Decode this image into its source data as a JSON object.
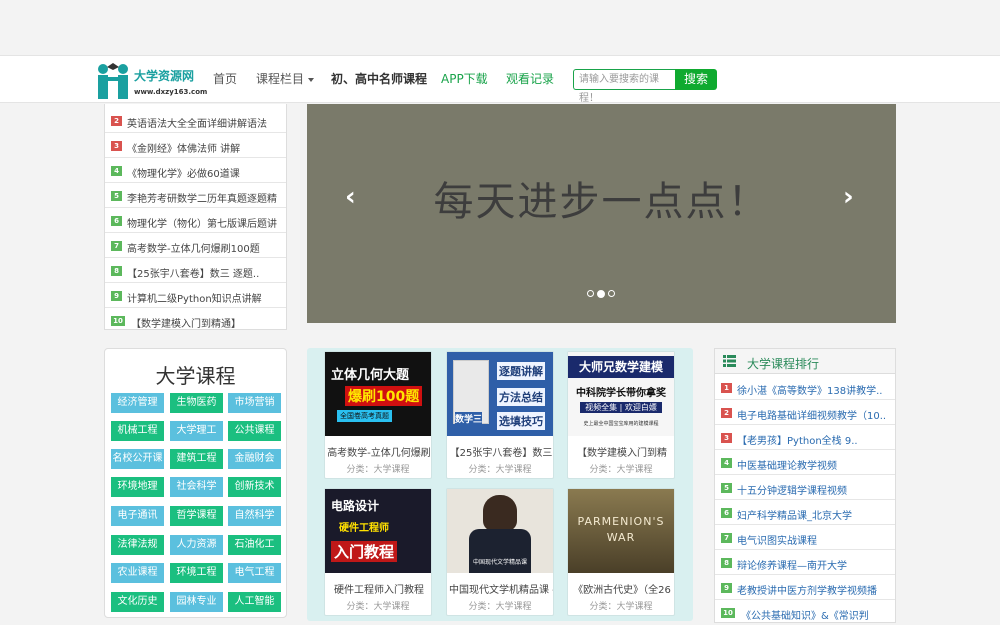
{
  "site": {
    "name": "大学资源网",
    "url": "www.dxzy163.com"
  },
  "nav": {
    "home": "首页",
    "courses": "课程栏目",
    "teachers": "初、高中名师课程",
    "app": "APP下载",
    "history": "观看记录",
    "search_placeholder": "请输入要搜索的课程！",
    "search_button": "搜索"
  },
  "left_list": [
    {
      "num": "2",
      "text": "英语语法大全全面详细讲解语法",
      "color": "#d9534f"
    },
    {
      "num": "3",
      "text": "《金刚经》体佛法师 讲解",
      "color": "#d9534f"
    },
    {
      "num": "4",
      "text": "《物理化学》必做60道课",
      "color": "#5cb85c"
    },
    {
      "num": "5",
      "text": "李艳芳考研数学二历年真题逐题精",
      "color": "#5cb85c"
    },
    {
      "num": "6",
      "text": "物理化学（物化）第七版课后题讲",
      "color": "#5cb85c"
    },
    {
      "num": "7",
      "text": "高考数学-立体几何爆刷100题",
      "color": "#5cb85c"
    },
    {
      "num": "8",
      "text": "【25张宇八套卷】数三 逐题..",
      "color": "#5cb85c"
    },
    {
      "num": "9",
      "text": "计算机二级Python知识点讲解",
      "color": "#5cb85c"
    },
    {
      "num": "10",
      "text": "【数学建模入门到精通】",
      "color": "#5cb85c"
    }
  ],
  "banner": {
    "text": "每天进步一点点！",
    "prev": "‹",
    "next": "›"
  },
  "categories": {
    "title": "大学课程",
    "tags": [
      {
        "label": "经济管理",
        "style": "blue"
      },
      {
        "label": "生物医药",
        "style": "green"
      },
      {
        "label": "市场营销",
        "style": "blue"
      },
      {
        "label": "机械工程",
        "style": "green"
      },
      {
        "label": "大学理工",
        "style": "blue"
      },
      {
        "label": "公共课程",
        "style": "green"
      },
      {
        "label": "名校公开课",
        "style": "blue"
      },
      {
        "label": "建筑工程",
        "style": "green"
      },
      {
        "label": "金融财会",
        "style": "blue"
      },
      {
        "label": "环境地理",
        "style": "green"
      },
      {
        "label": "社会科学",
        "style": "blue"
      },
      {
        "label": "创新技术",
        "style": "green"
      },
      {
        "label": "电子通讯",
        "style": "blue"
      },
      {
        "label": "哲学课程",
        "style": "green"
      },
      {
        "label": "自然科学",
        "style": "blue"
      },
      {
        "label": "法律法规",
        "style": "green"
      },
      {
        "label": "人力资源",
        "style": "blue"
      },
      {
        "label": "石油化工",
        "style": "green"
      },
      {
        "label": "农业课程",
        "style": "blue"
      },
      {
        "label": "环境工程",
        "style": "green"
      },
      {
        "label": "电气工程",
        "style": "blue"
      },
      {
        "label": "文化历史",
        "style": "green"
      },
      {
        "label": "园林专业",
        "style": "blue"
      },
      {
        "label": "人工智能",
        "style": "green"
      }
    ]
  },
  "cards": [
    {
      "title": "高考数学-立体几何爆刷",
      "category": "分类：大学课程",
      "thumb_line1": "立体几何大题",
      "thumb_line2": "爆刷100题",
      "thumb_line3": "全国卷高考真题"
    },
    {
      "title": "【25张宇八套卷】数三",
      "category": "分类：大学课程",
      "thumb_line1": "逐题讲解",
      "thumb_line2": "方法总结",
      "thumb_line3": "选填技巧",
      "thumb_line4": "数学三"
    },
    {
      "title": "【数学建模入门到精",
      "category": "分类：大学课程",
      "thumb_line1": "大师兄数学建模",
      "thumb_line2": "中科院学长带你拿奖",
      "thumb_line3": "视频全集 | 欢迎白嫖",
      "thumb_line4": "史上最全中国宝宝库用的建模课程"
    },
    {
      "title": "硬件工程师入门教程",
      "category": "分类：大学课程",
      "thumb_line1": "电路设计",
      "thumb_line2": "硬件工程师",
      "thumb_line3": "入门教程"
    },
    {
      "title": "中国现代文学机精品课 -",
      "category": "分类：大学课程",
      "thumb_line1": "中国现代文学精品课"
    },
    {
      "title": "《欧洲古代史》（全26",
      "category": "分类：大学课程",
      "thumb_line1": "PARMENION'S",
      "thumb_line2": "WAR"
    }
  ],
  "ranking": {
    "title": "大学课程排行",
    "items": [
      {
        "num": "1",
        "text": "徐小湛《高等数学》138讲教学..",
        "color": "#d9534f"
      },
      {
        "num": "2",
        "text": "电子电路基础详细视频教学（10..",
        "color": "#d9534f"
      },
      {
        "num": "3",
        "text": "【老男孩】Python全栈 9..",
        "color": "#d9534f"
      },
      {
        "num": "4",
        "text": "中医基础理论教学视频",
        "color": "#5cb85c"
      },
      {
        "num": "5",
        "text": "十五分钟逻辑学课程视频",
        "color": "#5cb85c"
      },
      {
        "num": "6",
        "text": "妇产科学精品课_北京大学",
        "color": "#5cb85c"
      },
      {
        "num": "7",
        "text": "电气识图实战课程",
        "color": "#5cb85c"
      },
      {
        "num": "8",
        "text": "辩论修养课程—南开大学",
        "color": "#5cb85c"
      },
      {
        "num": "9",
        "text": "老教授讲中医方剂学教学视频播",
        "color": "#5cb85c"
      },
      {
        "num": "10",
        "text": "《公共基础知识》&《常识判",
        "color": "#5cb85c"
      }
    ]
  }
}
